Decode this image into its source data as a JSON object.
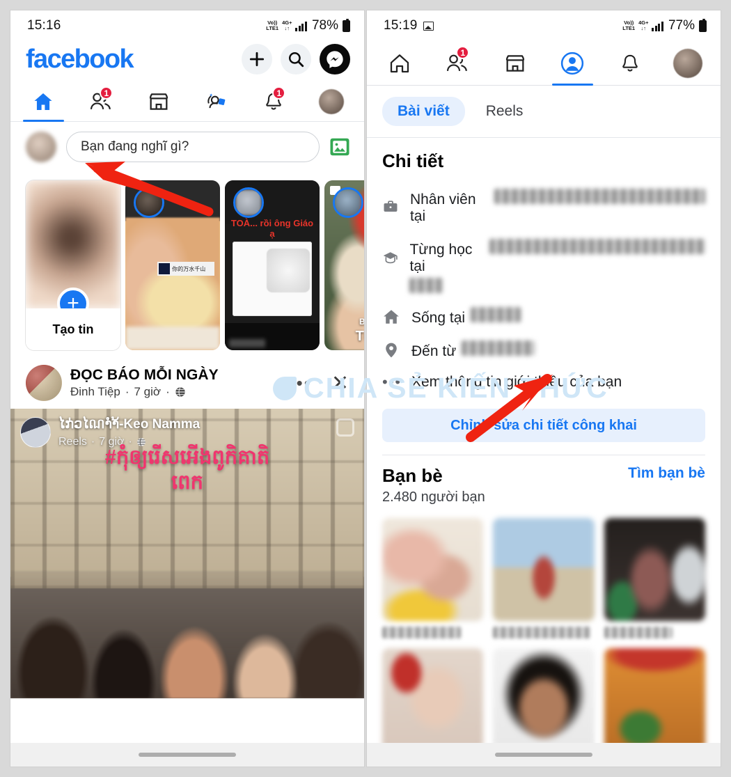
{
  "left_phone": {
    "status_bar": {
      "time": "15:16",
      "network_label_top": "Vo))",
      "network_label_bottom": "LTE1",
      "data_label": "4G+",
      "battery": "78%"
    },
    "app_bar": {
      "logo": "facebook",
      "actions": [
        {
          "name": "create-button",
          "icon": "plus-icon"
        },
        {
          "name": "search-button",
          "icon": "search-icon"
        },
        {
          "name": "messenger-button",
          "icon": "messenger-icon"
        }
      ]
    },
    "nav_tabs": [
      {
        "name": "home",
        "icon": "home-icon",
        "active": true,
        "badge": ""
      },
      {
        "name": "friends",
        "icon": "friends-icon",
        "active": false,
        "badge": "1"
      },
      {
        "name": "marketplace",
        "icon": "marketplace-icon",
        "active": false,
        "badge": ""
      },
      {
        "name": "groups",
        "icon": "groups-icon",
        "active": false,
        "badge": ""
      },
      {
        "name": "notifications",
        "icon": "bell-icon",
        "active": false,
        "badge": "1"
      },
      {
        "name": "profile",
        "icon": "avatar-icon",
        "active": false,
        "badge": ""
      }
    ],
    "composer": {
      "placeholder": "Bạn đang nghĩ gì?",
      "photo_icon": "photo-gallery-icon"
    },
    "stories": [
      {
        "label": "Tạo tin",
        "type": "create"
      },
      {
        "label": "",
        "type": "story",
        "overlay_text": "你的万水千山"
      },
      {
        "label": "",
        "type": "story",
        "overlay_text": "TOÀ... rồi ông Giáo ạ"
      },
      {
        "label": "",
        "type": "story",
        "overlay_text": "Tư N"
      }
    ],
    "post": {
      "page_name": "ĐỌC BÁO MỖI NGÀY",
      "author": "Đinh Tiệp",
      "time": "7 giờ",
      "audience_icon": "globe-icon",
      "more_icon": "ellipsis-icon",
      "close_icon": "close-icon",
      "reel": {
        "author": "ໄກ່ວໄណາໍຳ້-Keo Namma",
        "subtitle": "Reels",
        "time": "7 giờ",
        "audience_icon": "globe-icon",
        "overlay_text_line1": "#កុំឲ្យរើសអើងពូកិគាតិ",
        "overlay_text_line2": "ពេក"
      }
    }
  },
  "right_phone": {
    "status_bar": {
      "time": "15:19",
      "screenshot_icon": "image-icon",
      "network_label_top": "Vo))",
      "network_label_bottom": "LTE1",
      "data_label": "4G+",
      "battery": "77%"
    },
    "nav_tabs": [
      {
        "name": "home",
        "icon": "home-icon",
        "active": false,
        "badge": ""
      },
      {
        "name": "friends",
        "icon": "friends-icon",
        "active": false,
        "badge": "1"
      },
      {
        "name": "marketplace",
        "icon": "marketplace-icon",
        "active": false,
        "badge": ""
      },
      {
        "name": "profile",
        "icon": "profile-filled-icon",
        "active": true,
        "badge": ""
      },
      {
        "name": "notifications",
        "icon": "bell-icon",
        "active": false,
        "badge": ""
      },
      {
        "name": "menu",
        "icon": "avatar-icon",
        "active": false,
        "badge": ""
      }
    ],
    "content_tabs": [
      {
        "label": "Bài viết",
        "active": true
      },
      {
        "label": "Reels",
        "active": false
      }
    ],
    "details": {
      "title": "Chi tiết",
      "rows": [
        {
          "icon": "briefcase-icon",
          "label": "Nhân viên tại",
          "value_redacted": true,
          "redacted_width": 330
        },
        {
          "icon": "graduation-cap-icon",
          "label": "Từng học tại",
          "value_redacted": true,
          "redacted_width": 345,
          "redacted_width_2": 48
        },
        {
          "icon": "home-filled-icon",
          "label": "Sống tại",
          "value_redacted": true,
          "redacted_width": 72
        },
        {
          "icon": "location-pin-icon",
          "label": "Đến từ",
          "value_redacted": true,
          "redacted_width": 105
        },
        {
          "icon": "ellipsis-icon",
          "label": "Xem thông tin giới thiệu của bạn",
          "value_redacted": false
        }
      ],
      "edit_button": "Chỉnh sửa chi tiết công khai"
    },
    "friends": {
      "title": "Bạn bè",
      "count": "2.480 người bạn",
      "find_link": "Tìm bạn bè",
      "cells": [
        {
          "name_redacted": true
        },
        {
          "name_redacted": true
        },
        {
          "name_redacted": true
        },
        {
          "name_redacted": false
        },
        {
          "name_redacted": false
        },
        {
          "name_redacted": false
        }
      ]
    }
  },
  "watermark": {
    "text": "CHIA SẺ KIẾN THỨC",
    "color": "#cfe6f7"
  },
  "annotations": {
    "arrow_color": "#ef2311",
    "arrows": [
      {
        "name": "arrow-to-profile-avatar",
        "target": "left profile avatar in composer"
      },
      {
        "name": "arrow-to-see-about-info",
        "target": "Xem thông tin giới thiệu của bạn"
      }
    ]
  },
  "colors": {
    "brand_blue": "#1877F2",
    "badge_red": "#E41E3F",
    "pill_bg": "#e7f0fd",
    "page_bg": "#d9d9d9"
  }
}
